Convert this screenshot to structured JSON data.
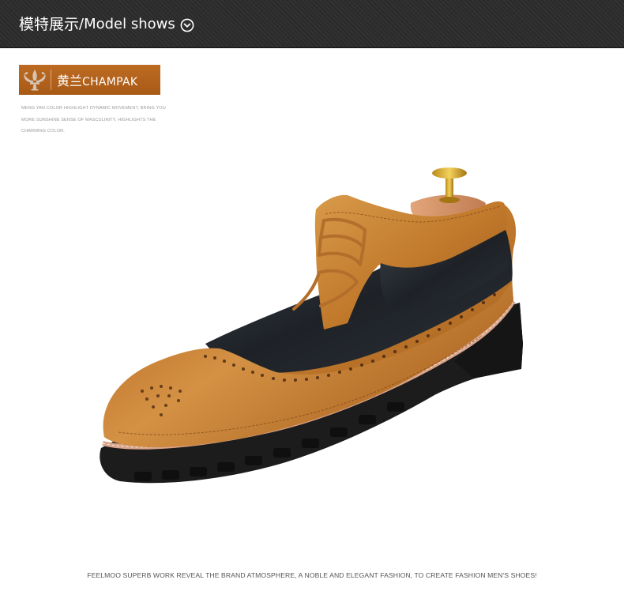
{
  "header": {
    "title_cn": "模特展示",
    "title_en": "/Model shows",
    "icon": "chevron-down-circle-icon"
  },
  "badge": {
    "icon": "fleur-de-lis-icon",
    "label_cn": "黄兰",
    "label_en": "CHAMPAK",
    "description": "MENG YAN COLOR HIGHLIGHT DYNAMIC MOVEMENT, BRING YOU MORE SUNSHINE SENSE OF MASCULINITY, HIGHLIGHTS THE CHARMING COLOR."
  },
  "product": {
    "image": "brogue-shoe-photo"
  },
  "footer": {
    "text": "FEELMOO SUPERB WORK REVEAL THE BRAND ATMOSPHERE, A NOBLE AND ELEGANT FASHION, TO CREATE FASHION MEN'S SHOES!"
  },
  "colors": {
    "header_bg": "#2a2a2a",
    "badge_bg": "#b5641c",
    "leather_tan": "#c07a2c",
    "leather_black": "#1f2226",
    "sole": "#1c1c1c"
  }
}
